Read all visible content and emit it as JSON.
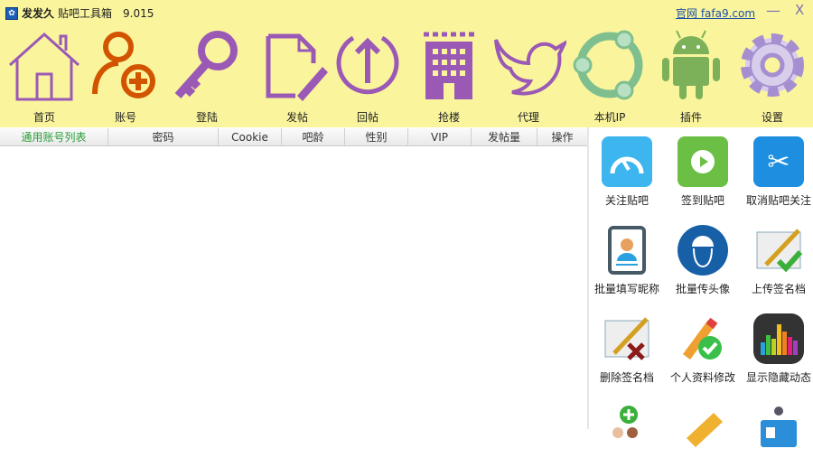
{
  "window": {
    "app_name": "发发久",
    "app_subtitle": "贴吧工具箱",
    "version": "9.015",
    "site_link": "官网 fafa9.com",
    "minimize": "—",
    "close": "X"
  },
  "toolbar": [
    {
      "label": "首页",
      "icon": "home-icon"
    },
    {
      "label": "账号",
      "icon": "add-user-icon"
    },
    {
      "label": "登陆",
      "icon": "key-icon"
    },
    {
      "label": "发帖",
      "icon": "edit-document-icon"
    },
    {
      "label": "回帖",
      "icon": "upload-circle-icon"
    },
    {
      "label": "抢楼",
      "icon": "building-icon"
    },
    {
      "label": "代理",
      "icon": "bird-icon"
    },
    {
      "label": "本机IP",
      "icon": "network-ring-icon"
    },
    {
      "label": "插件",
      "icon": "android-icon"
    },
    {
      "label": "设置",
      "icon": "gear-icon"
    }
  ],
  "table": {
    "columns": [
      "通用账号列表",
      "密码",
      "Cookie",
      "吧龄",
      "性别",
      "VIP",
      "发帖量",
      "操作"
    ],
    "rows": []
  },
  "tools": [
    {
      "label": "关注贴吧",
      "icon": "speedometer-icon"
    },
    {
      "label": "签到贴吧",
      "icon": "play-icon"
    },
    {
      "label": "取消贴吧关注",
      "icon": "scissors-icon"
    },
    {
      "label": "批量填写昵称",
      "icon": "id-badge-icon"
    },
    {
      "label": "批量传头像",
      "icon": "helmet-head-icon"
    },
    {
      "label": "上传签名档",
      "icon": "signature-upload-icon"
    },
    {
      "label": "删除签名档",
      "icon": "signature-delete-icon"
    },
    {
      "label": "个人资料修改",
      "icon": "pencil-check-icon"
    },
    {
      "label": "显示隐藏动态",
      "icon": "equalizer-icon"
    },
    {
      "label": "",
      "icon": "add-users-icon"
    },
    {
      "label": "",
      "icon": "ticket-icon"
    },
    {
      "label": "",
      "icon": "id-card-icon"
    }
  ]
}
